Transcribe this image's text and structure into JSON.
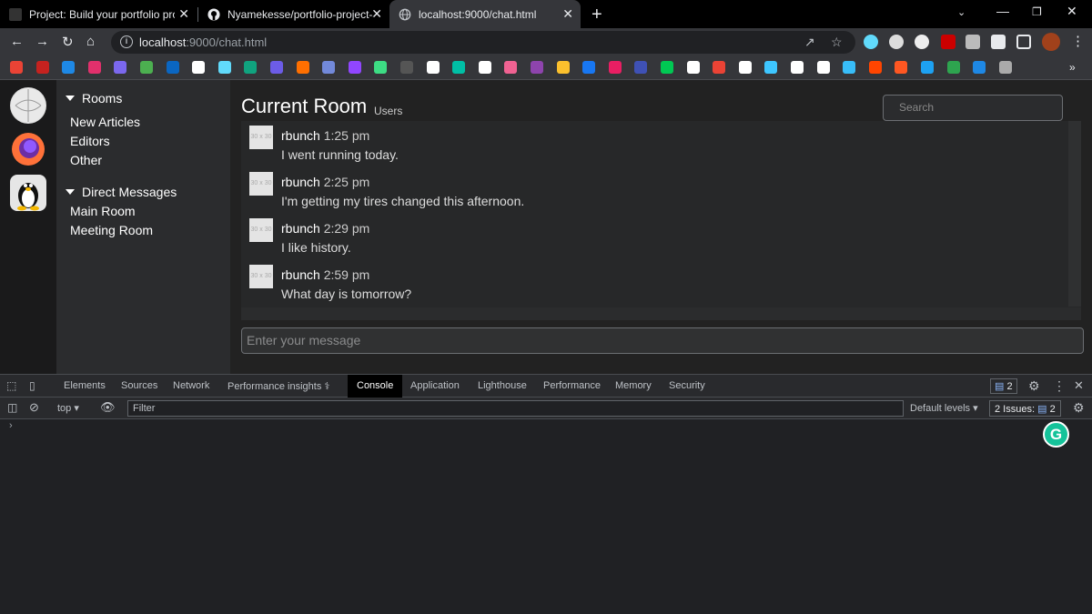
{
  "browser": {
    "tabs": [
      {
        "title": "Project: Build your portfolio proje",
        "close": "✕"
      },
      {
        "title": "Nyamekesse/portfolio-project-sl",
        "close": "✕"
      },
      {
        "title": "localhost:9000/chat.html",
        "close": "✕"
      }
    ],
    "new_tab": "+",
    "url_host": "localhost",
    "url_rest": ":9000/chat.html",
    "bookmark_colors": [
      "#ea4335",
      "#c5221f",
      "#1e88e5",
      "#e1306c",
      "#7b68ee",
      "#4caf50",
      "#0a66c2",
      "#ffffff",
      "#61dafb",
      "#10a37f",
      "#6c5ce7",
      "#ff6f00",
      "#7289da",
      "#9146ff",
      "#3ddc84",
      "#555555",
      "#ffffff",
      "#00bfa5",
      "#ffffff",
      "#f06292",
      "#8e44ad",
      "#fbc02d",
      "#1877f2",
      "#e91e63",
      "#3f51b5",
      "#00c853",
      "#ffffff",
      "#ea4335",
      "#ffffff",
      "#3ec6ff",
      "#ffffff",
      "#ffffff",
      "#38bdf8",
      "#ff4500",
      "#ff5722",
      "#1da1f2",
      "#2ea44f",
      "#1e88e5",
      "#aaaaaa"
    ]
  },
  "app": {
    "sections": [
      {
        "title": "Rooms",
        "items": [
          "New Articles",
          "Editors",
          "Other"
        ]
      },
      {
        "title": "Direct Messages",
        "items": [
          "Main Room",
          "Meeting Room"
        ]
      }
    ],
    "room_title": "Current Room",
    "room_subtitle": "Users",
    "search_placeholder": "Search",
    "avatar_text": "30 x 30",
    "messages": [
      {
        "user": "rbunch",
        "time": "1:25 pm",
        "text": "I went running today."
      },
      {
        "user": "rbunch",
        "time": "2:25 pm",
        "text": "I'm getting my tires changed this afternoon."
      },
      {
        "user": "rbunch",
        "time": "2:29 pm",
        "text": "I like history."
      },
      {
        "user": "rbunch",
        "time": "2:59 pm",
        "text": "What day is tomorrow?"
      }
    ],
    "message_placeholder": "Enter your message"
  },
  "devtools": {
    "tabs": [
      "Elements",
      "Sources",
      "Network",
      "Performance insights",
      "Console",
      "Application",
      "Lighthouse",
      "Performance",
      "Memory",
      "Security"
    ],
    "active_tab": "Console",
    "message_count": "2",
    "context": "top",
    "filter_placeholder": "Filter",
    "levels": "Default levels",
    "issues_label": "2 Issues:",
    "issues_count": "2",
    "prompt": "›"
  },
  "grammarly": "G"
}
